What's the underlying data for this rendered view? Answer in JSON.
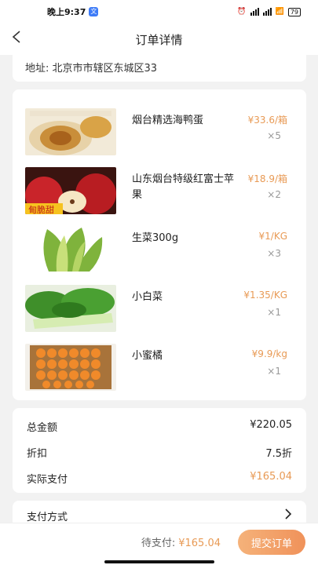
{
  "status": {
    "time": "晚上9:37",
    "badge": "文",
    "battery": "79"
  },
  "nav": {
    "title": "订单详情"
  },
  "address": {
    "label": "地址:",
    "value": "北京市市辖区东城区33"
  },
  "items": [
    {
      "name": "烟台精选海鸭蛋",
      "price": "¥33.6/箱",
      "qty": "×5",
      "image_icon": "duck-egg-image"
    },
    {
      "name": "山东烟台特级红富士苹果",
      "price": "¥18.9/箱",
      "qty": "×2",
      "image_icon": "apple-image"
    },
    {
      "name": "生菜300g",
      "price": "¥1/KG",
      "qty": "×3",
      "image_icon": "lettuce-image"
    },
    {
      "name": "小白菜",
      "price": "¥1.35/KG",
      "qty": "×1",
      "image_icon": "bok-choy-image"
    },
    {
      "name": "小蜜橘",
      "price": "¥9.9/kg",
      "qty": "×1",
      "image_icon": "tangerine-image"
    }
  ],
  "image_text": {
    "apple_banner": "甸脆甜"
  },
  "summary": {
    "total_label": "总金额",
    "total_value": "¥220.05",
    "discount_label": "折扣",
    "discount_value": "7.5折",
    "paid_label": "实际支付",
    "paid_value": "¥165.04"
  },
  "payment": {
    "label": "支付方式"
  },
  "bottom": {
    "due_label": "待支付:",
    "due_value": "¥165.04",
    "submit_label": "提交订单"
  },
  "colors": {
    "accent": "#e89a55",
    "button": "#f0925a"
  }
}
